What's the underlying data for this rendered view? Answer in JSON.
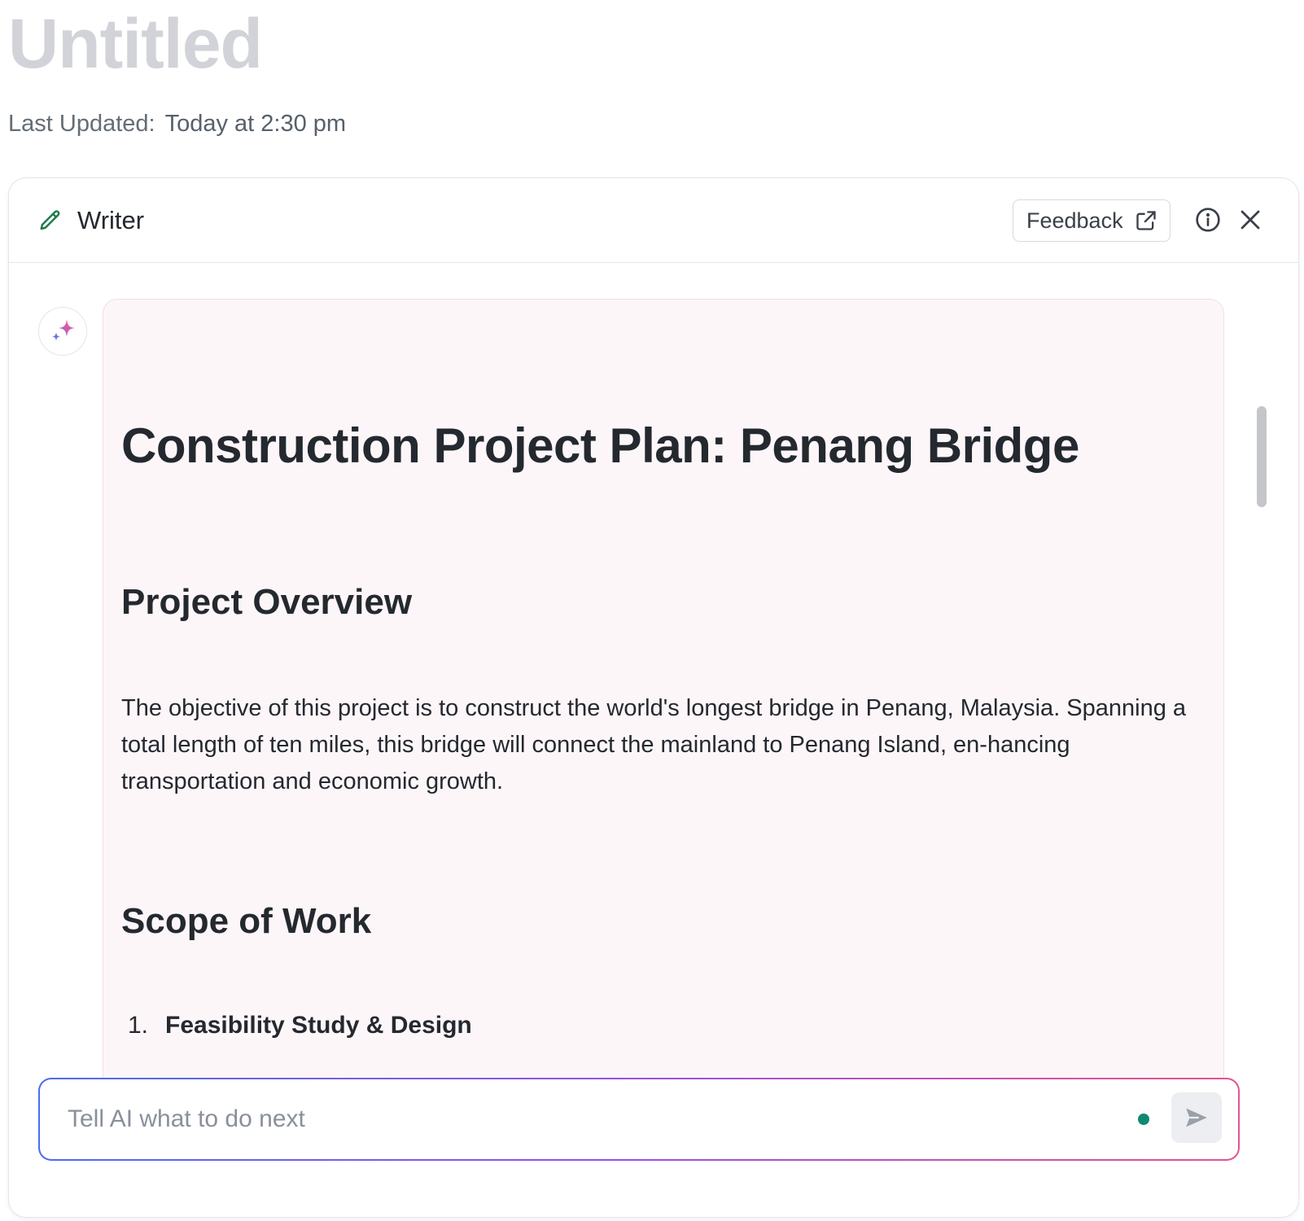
{
  "document": {
    "title": "Untitled",
    "last_updated_label": "Last Updated:",
    "last_updated_value": "Today at 2:30 pm"
  },
  "panel": {
    "header": {
      "tool_icon": "pencil-icon",
      "tool_name": "Writer",
      "feedback_label": "Feedback",
      "feedback_icon": "external-link-icon",
      "info_icon": "info-icon",
      "close_icon": "close-icon"
    },
    "assistant_avatar_icon": "sparkle-icon",
    "response": {
      "title": "Construction Project Plan: Penang Bridge",
      "section_overview_heading": "Project Overview",
      "section_overview_text": "The objective of this project is to construct the world's longest bridge in Penang, Malaysia. Spanning a total length of ten miles, this bridge will connect the mainland to Penang Island, en-hancing transportation and economic growth.",
      "section_scope_heading": "Scope of Work",
      "scope_items": [
        {
          "number": "1.",
          "text": "Feasibility Study & Design"
        }
      ]
    },
    "prompt": {
      "placeholder": "Tell AI what to do next",
      "value": "",
      "send_icon": "send-icon"
    }
  },
  "colors": {
    "title_muted": "#d2d3d8",
    "card_background": "#fdf6f9",
    "status_dot": "#0e8a70",
    "pencil_accent": "#1f7a4d",
    "gradient_start": "#4b6cf0",
    "gradient_end": "#e2558f"
  }
}
